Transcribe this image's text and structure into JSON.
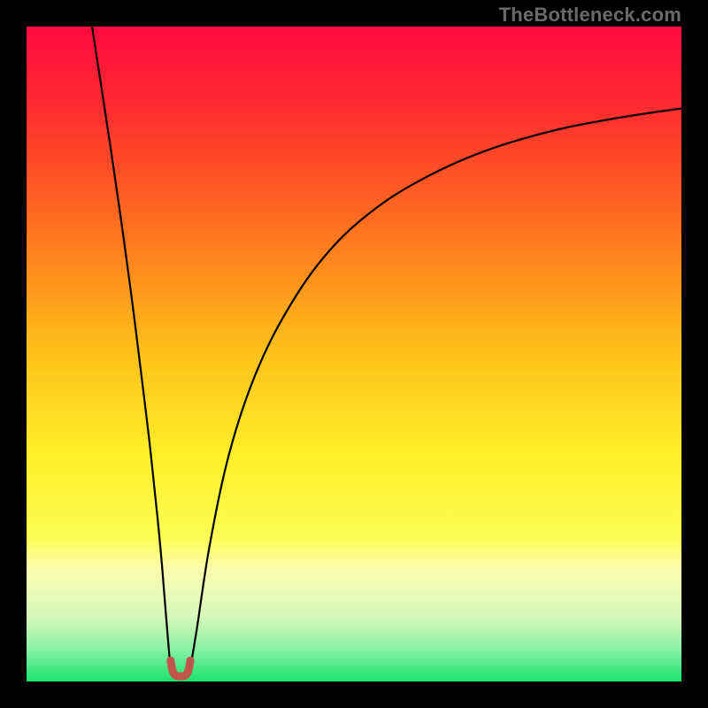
{
  "watermark": "TheBottleneck.com",
  "chart_data": {
    "type": "line",
    "title": "",
    "xlabel": "",
    "ylabel": "",
    "xlim": [
      0,
      100
    ],
    "ylim": [
      0,
      100
    ],
    "grid": false,
    "legend": false,
    "annotations": [],
    "background_gradient_stops": [
      {
        "pos": 0.0,
        "color": "#ff0a3e"
      },
      {
        "pos": 0.12,
        "color": "#ff2a30"
      },
      {
        "pos": 0.3,
        "color": "#ff6e1f"
      },
      {
        "pos": 0.5,
        "color": "#ffc21a"
      },
      {
        "pos": 0.66,
        "color": "#fff029"
      },
      {
        "pos": 0.78,
        "color": "#fdfd55"
      },
      {
        "pos": 0.83,
        "color": "#fbfdb0"
      },
      {
        "pos": 0.9,
        "color": "#d6f8bc"
      },
      {
        "pos": 0.95,
        "color": "#8cf1a3"
      },
      {
        "pos": 1.0,
        "color": "#19e36f"
      }
    ],
    "series": [
      {
        "name": "bottleneck-curve-left",
        "color": "#000000",
        "width": 2.2,
        "x": [
          10.0,
          12.0,
          14.0,
          16.0,
          18.0,
          19.0,
          20.0,
          20.7,
          21.3,
          21.8,
          22.0
        ],
        "y": [
          100.0,
          87.0,
          73.5,
          59.0,
          43.0,
          34.5,
          25.0,
          17.5,
          10.0,
          4.0,
          2.0
        ]
      },
      {
        "name": "bottleneck-curve-right",
        "color": "#000000",
        "width": 2.2,
        "x": [
          25.0,
          26.0,
          28.0,
          31.0,
          35.0,
          40.0,
          46.0,
          53.0,
          61.0,
          70.0,
          80.0,
          90.0,
          100.0
        ],
        "y": [
          2.0,
          8.0,
          21.0,
          35.0,
          47.0,
          57.0,
          65.5,
          72.0,
          77.0,
          81.0,
          84.0,
          86.0,
          87.5
        ]
      },
      {
        "name": "bottleneck-minimum-marker",
        "type": "marker",
        "color": "#c0564b",
        "width": 9,
        "x": [
          22.0,
          22.3,
          22.8,
          23.5,
          24.2,
          24.7,
          25.0
        ],
        "y": [
          3.2,
          1.6,
          0.9,
          0.8,
          0.9,
          1.6,
          3.2
        ]
      }
    ]
  }
}
